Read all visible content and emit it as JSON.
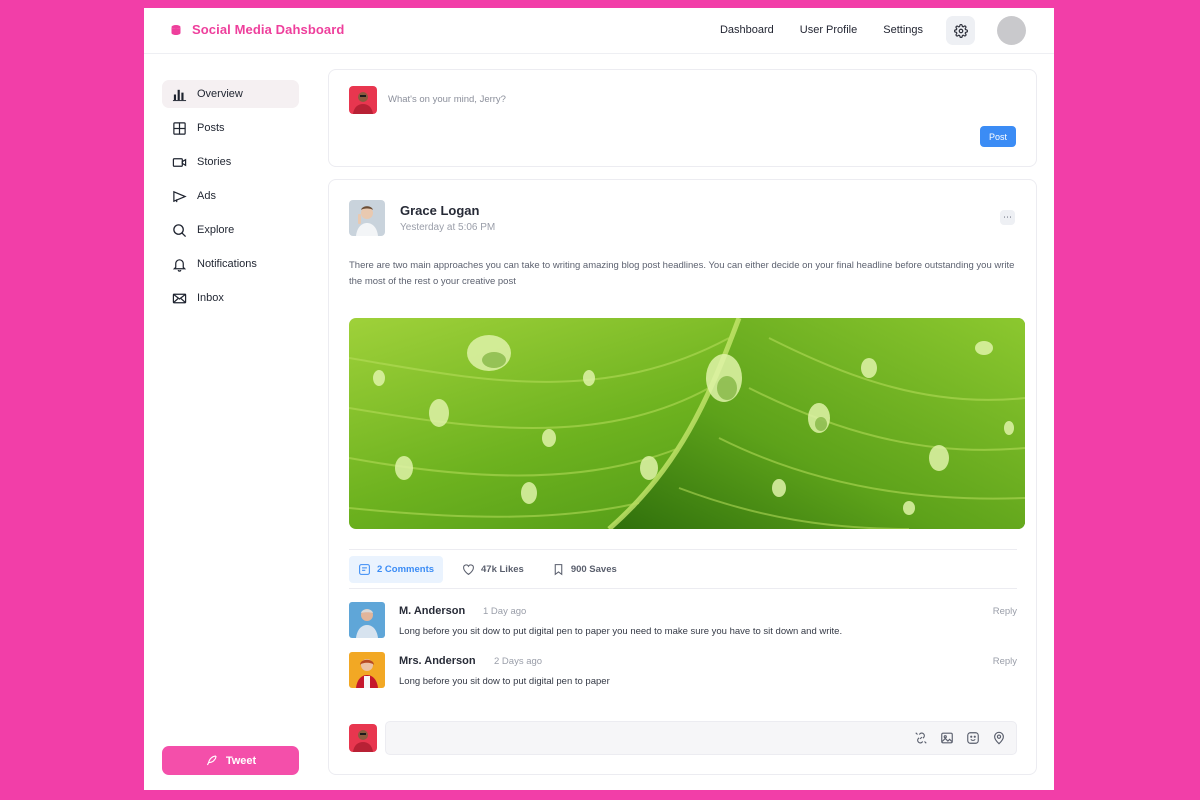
{
  "app": {
    "title": "Social Media Dahsboard"
  },
  "nav": {
    "items": [
      "Dashboard",
      "User Profile",
      "Settings"
    ]
  },
  "sidebar": {
    "items": [
      {
        "label": "Overview",
        "icon": "bar-chart-icon",
        "active": true
      },
      {
        "label": "Posts",
        "icon": "grid-icon"
      },
      {
        "label": "Stories",
        "icon": "video-icon"
      },
      {
        "label": "Ads",
        "icon": "megaphone-icon"
      },
      {
        "label": "Explore",
        "icon": "search-icon"
      },
      {
        "label": "Notifications",
        "icon": "bell-icon"
      },
      {
        "label": "Inbox",
        "icon": "mail-icon"
      }
    ],
    "tweet_label": "Tweet"
  },
  "composer": {
    "placeholder": "What's on your mind, Jerry?",
    "post_label": "Post"
  },
  "post": {
    "author": "Grace Logan",
    "time": "Yesterday at 5:06 PM",
    "text": "There are two main approaches you can take to writing amazing blog post headlines. You can either decide on your final headline before outstanding you write the most of the rest o your creative post",
    "image": "leaf-with-water-drops",
    "actions": {
      "comments": "2 Comments",
      "likes": "47k Likes",
      "saves": "900 Saves"
    }
  },
  "comments": [
    {
      "name": "M. Anderson",
      "time": "1 Day ago",
      "text": "Long before you sit dow to put digital pen to paper you need to make sure you have to sit down and write.",
      "reply": "Reply"
    },
    {
      "name": "Mrs. Anderson",
      "time": "2 Days ago",
      "text": "Long before you sit dow to put digital pen to paper",
      "reply": "Reply"
    }
  ],
  "colors": {
    "background": "#f23ea8",
    "brand": "#ee3f9c",
    "accent_blue": "#3b8cf5",
    "tweet": "#f44faa"
  }
}
